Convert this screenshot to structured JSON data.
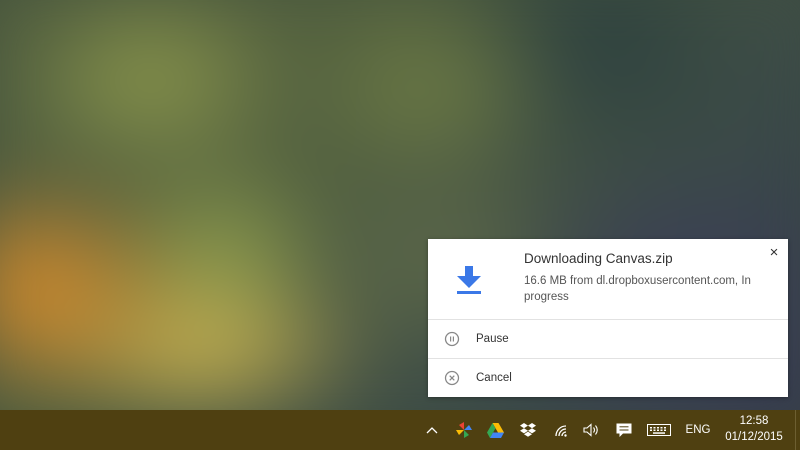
{
  "notification": {
    "title": "Downloading Canvas.zip",
    "message": "16.6 MB from dl.dropboxusercontent.com, In progress",
    "close_label": "×",
    "icon": "download-icon",
    "actions": [
      {
        "label": "Pause",
        "icon": "pause-icon"
      },
      {
        "label": "Cancel",
        "icon": "cancel-icon"
      }
    ]
  },
  "taskbar": {
    "tray_icons": [
      "chevron-up-icon",
      "google-photos-icon",
      "google-drive-icon",
      "dropbox-icon",
      "wifi-icon",
      "volume-icon",
      "action-center-icon",
      "keyboard-icon"
    ],
    "language": "ENG",
    "time": "12:58",
    "date": "01/12/2015"
  },
  "colors": {
    "accent": "#3b78e7",
    "taskbar": "#4f4011"
  }
}
